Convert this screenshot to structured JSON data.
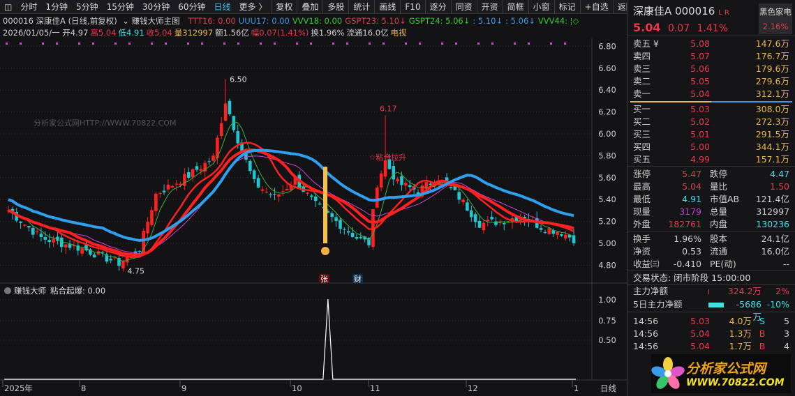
{
  "toolbar": {
    "items": [
      "分时",
      "1分钟",
      "5分钟",
      "15分钟",
      "30分钟",
      "60分钟",
      "日线",
      "更多 〉",
      "复权",
      "叠加",
      "多股",
      "统计",
      "画线",
      "F10",
      "逐分",
      "同资",
      "开资",
      "简框",
      "小窗",
      "标记",
      "+自选",
      "返回"
    ],
    "active": "日线"
  },
  "indicator_line": {
    "title": "000016 深康佳A (日线,前复权)",
    "formula": "赚钱大师主图",
    "values": [
      {
        "t": "TTT16: 0.00",
        "c": "#e8394d"
      },
      {
        "t": "UUU17: 0.00",
        "c": "#3a9be8"
      },
      {
        "t": "VVV18: 0.00",
        "c": "#2fd02f"
      },
      {
        "t": "GSPT23: 5.10↓",
        "c": "#e8394d"
      },
      {
        "t": "GSPT24: 5.06↓",
        "c": "#2fd02f"
      },
      {
        "t": ": 5.10↓",
        "c": "#3a9be8"
      },
      {
        "t": ": 5.06↓",
        "c": "#3a9be8"
      },
      {
        "t": "VVV44: ¦◇",
        "c": "#2fd02f"
      }
    ]
  },
  "quote_line": [
    {
      "t": "2026/01/05/一 开4.97",
      "c": "#d0d0d0"
    },
    {
      "t": "高5.04",
      "c": "#e8394d"
    },
    {
      "t": "低4.91",
      "c": "#3fe0e8"
    },
    {
      "t": "收5.04",
      "c": "#e8394d"
    },
    {
      "t": "量312997",
      "c": "#e8b84a"
    },
    {
      "t": "额1.56亿",
      "c": "#d0d0d0"
    },
    {
      "t": "幅0.07(1.41%)",
      "c": "#e8394d"
    },
    {
      "t": "换1.96%",
      "c": "#d0d0d0"
    },
    {
      "t": "流通16.0亿",
      "c": "#d0d0d0"
    },
    {
      "t": "电视",
      "c": "#e8b84a"
    }
  ],
  "chart_data": {
    "type": "candlestick",
    "ylim": [
      4.7,
      6.9
    ],
    "price_ticks": [
      "6.80",
      "6.60",
      "6.40",
      "6.20",
      "6.00",
      "5.80",
      "5.60",
      "5.40",
      "5.20",
      "5.00",
      "4.80"
    ],
    "close_anchors": [
      [
        0,
        5.3
      ],
      [
        8,
        5.05
      ],
      [
        18,
        4.95
      ],
      [
        27,
        4.82
      ],
      [
        32,
        4.95
      ],
      [
        36,
        5.45
      ],
      [
        44,
        5.62
      ],
      [
        50,
        5.78
      ],
      [
        53,
        6.3
      ],
      [
        56,
        5.95
      ],
      [
        60,
        5.55
      ],
      [
        65,
        5.42
      ],
      [
        70,
        5.58
      ],
      [
        75,
        5.35
      ],
      [
        80,
        5.2
      ],
      [
        85,
        5.05
      ],
      [
        88,
        5.0
      ],
      [
        90,
        5.55
      ],
      [
        92,
        5.75
      ],
      [
        95,
        5.55
      ],
      [
        100,
        5.48
      ],
      [
        105,
        5.6
      ],
      [
        110,
        5.42
      ],
      [
        115,
        5.18
      ],
      [
        120,
        5.2
      ],
      [
        125,
        5.25
      ],
      [
        130,
        5.15
      ],
      [
        135,
        5.1
      ],
      [
        138,
        5.04
      ]
    ],
    "annotations": {
      "high": "6.50",
      "low": "4.75",
      "spike": "6.17",
      "signal": "☆粘合拉升",
      "tag_zhang": "张",
      "tag_cai": "财"
    },
    "watermark": "分析家公式网HTTP://WWW.70822.COM",
    "sub": {
      "title": "赚钱大师",
      "label": "粘合起爆: 0.00",
      "ticks": [
        "1.00",
        "0.75",
        "0.50"
      ],
      "spike_index": 78
    },
    "x_labels": [
      "2025年",
      "8",
      "9",
      "10",
      "11",
      "12",
      "1"
    ],
    "period": "日线"
  },
  "right": {
    "name": "深康佳A",
    "code": "000016",
    "lr": "L R",
    "price": "5.04",
    "change": "0.07",
    "pct": "1.41%",
    "sector": "黑色家电",
    "sector_pct": "2.16%",
    "asks": [
      [
        "卖五 ¥",
        "5.08",
        "147.6万"
      ],
      [
        "卖四",
        "5.07",
        "176.7万"
      ],
      [
        "卖三",
        "5.06",
        "179.6万"
      ],
      [
        "卖二",
        "5.05",
        "279.6万"
      ],
      [
        "卖一",
        "5.04",
        "312.1万"
      ]
    ],
    "bids": [
      [
        "买一",
        "5.03",
        "308.0万"
      ],
      [
        "买二",
        "5.02",
        "272.3万"
      ],
      [
        "买三",
        "5.01",
        "291.5万"
      ],
      [
        "买四",
        "5.00",
        "344.1万"
      ],
      [
        "买五",
        "4.99",
        "157.1万"
      ]
    ],
    "stats": [
      [
        "涨停",
        "5.47",
        "red",
        "跌停",
        "4.47",
        "cyan"
      ],
      [
        "最高",
        "5.04",
        "red",
        "量比",
        "1.50",
        "red"
      ],
      [
        "最低",
        "4.91",
        "cyan",
        "市值AB",
        "121.4亿",
        "wht"
      ],
      [
        "现量",
        "3179",
        "mag",
        "总量",
        "312997",
        "wht"
      ],
      [
        "外盘",
        "182761",
        "red",
        "内盘",
        "130236",
        "cyan"
      ]
    ],
    "stats2": [
      [
        "换手",
        "1.96%",
        "股本",
        "24.1亿"
      ],
      [
        "净资",
        "0.53",
        "流通",
        "16.0亿"
      ],
      [
        "收益㈢",
        "-0.410",
        "PE(动)",
        "--"
      ]
    ],
    "status": "交易状态: 闭市阶段 15:00:00",
    "flow": [
      [
        "主力净额",
        "324.2万",
        "2%"
      ],
      [
        "5日主力净额",
        "-5686万",
        "-10%"
      ]
    ],
    "ticks": [
      [
        "14:56",
        "5.03",
        "4.0万",
        "S",
        "5"
      ],
      [
        "14:56",
        "5.04",
        "1.3万",
        "B",
        "3"
      ],
      [
        "14:56",
        "5.04",
        "1.7万",
        "B",
        "4"
      ]
    ],
    "logo": {
      "cn": "分析家公式网",
      "url": "WWW.70822.COM"
    }
  }
}
